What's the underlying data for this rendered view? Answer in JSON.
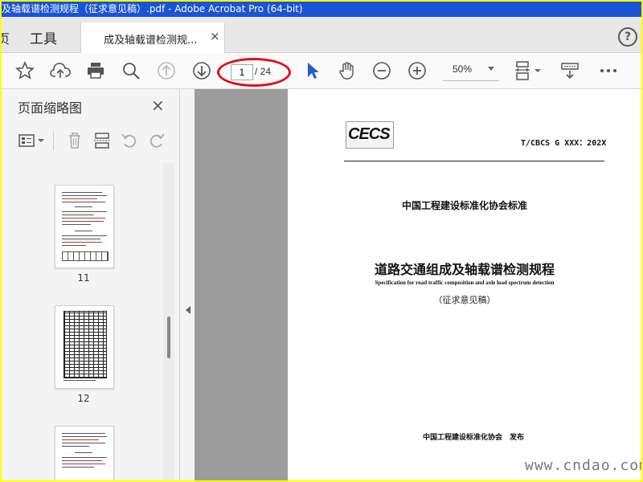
{
  "window": {
    "title": "及轴载谱检测规程（征求意见稿）.pdf - Adobe Acrobat Pro (64-bit)"
  },
  "tabs": {
    "home": "页",
    "tools": "工具",
    "document": "成及轴载谱检测规...",
    "close": "×"
  },
  "help": {
    "label": "?"
  },
  "toolbar": {
    "page_current": "1",
    "page_total": "/ 24",
    "zoom": "50%",
    "icons": [
      "star-icon",
      "cloud-upload-icon",
      "print-icon",
      "search-icon",
      "page-up-icon",
      "page-down-icon",
      "select-cursor-icon",
      "hand-icon",
      "zoom-out-icon",
      "zoom-in-icon",
      "fit-page-icon",
      "scroll-mode-icon",
      "more-icon"
    ],
    "highlight_color": "#e0101a",
    "cursor_color": "#1f5fcf"
  },
  "sidebar": {
    "title": "页面缩略图",
    "close": "×",
    "thumbnails": [
      {
        "label": "11"
      },
      {
        "label": "12"
      }
    ]
  },
  "document": {
    "logo_text": "CECS",
    "standard_no": "T/CBCS G XXX：202X",
    "association_standard": "中国工程建设标准化协会标准",
    "title_cn": "道路交通组成及轴载谱检测规程",
    "title_en": "Specification for road traffic composition and axle load spectrum detection",
    "draft_note": "（征求意见稿）",
    "publisher": "中国工程建设标准化协会　发布"
  },
  "watermark": {
    "site": "www.cndao.com"
  },
  "colors": {
    "titlebar": "#1a53d6",
    "frame": "#ffff00"
  }
}
